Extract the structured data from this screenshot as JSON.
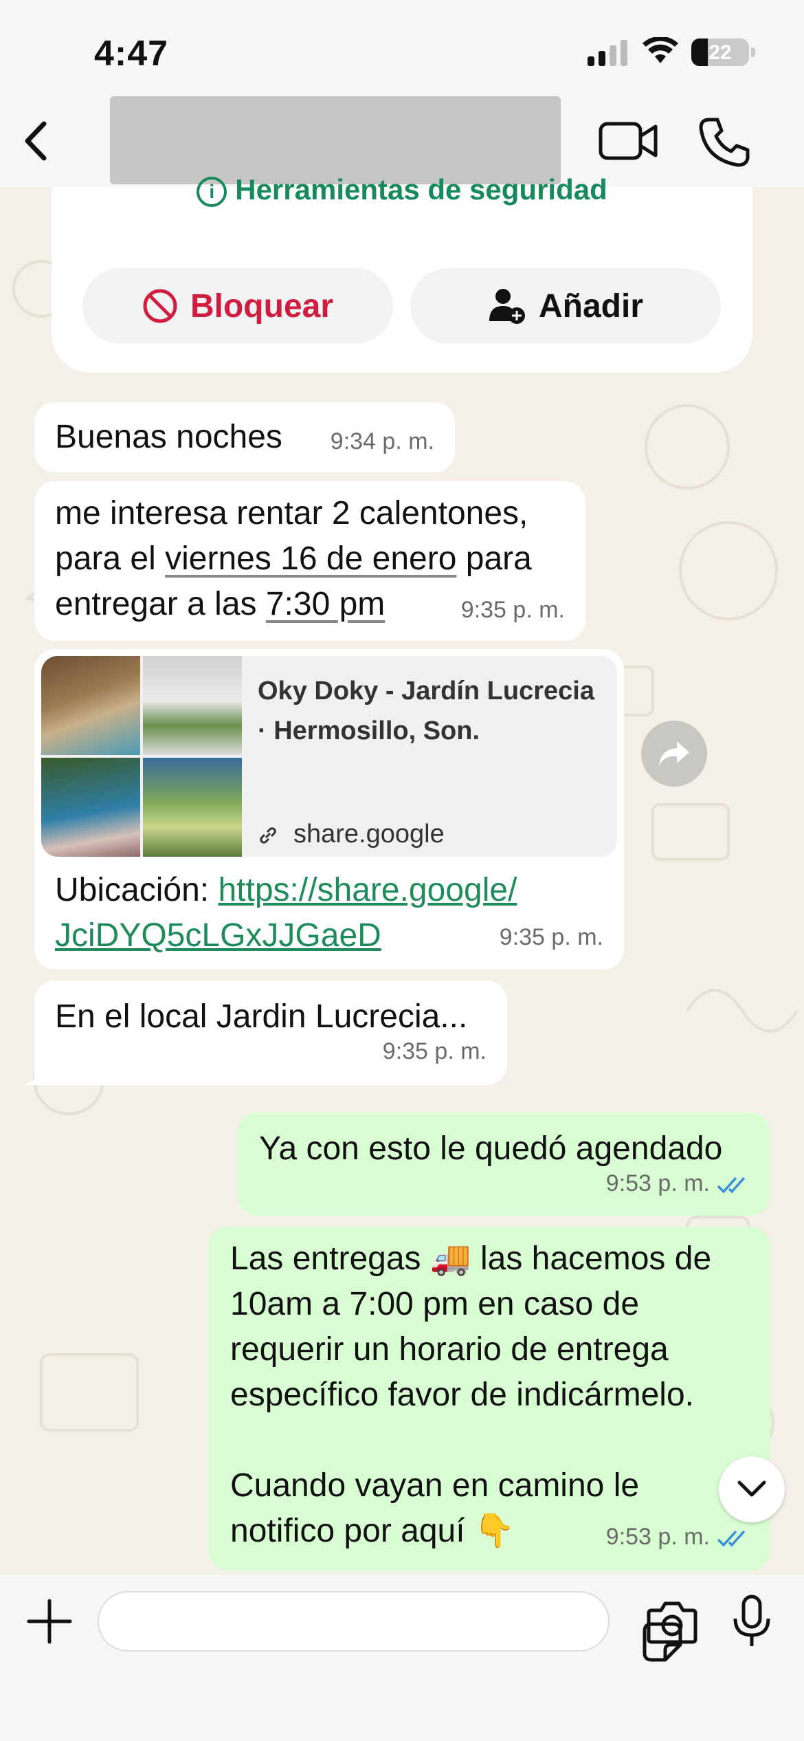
{
  "status_bar": {
    "time": "4:47",
    "battery": "22"
  },
  "header": {
    "contact_name": ""
  },
  "security_card": {
    "link_label": "Herramientas de seguridad",
    "block_label": "Bloquear",
    "add_label": "Añadir"
  },
  "messages": [
    {
      "dir": "in",
      "text": "Buenas noches",
      "time": "9:34 p. m."
    },
    {
      "dir": "in",
      "text_parts": [
        "me interesa rentar 2 calentones,",
        "para el ",
        "viernes 16 de enero",
        " para",
        "entregar a las ",
        "7:30 pm"
      ],
      "time": "9:35 p. m."
    },
    {
      "dir": "in",
      "location": {
        "title": "Oky Doky - Jardín Lucrecia · Hermosillo, Son.",
        "domain": "share.google"
      },
      "text_prefix": "Ubicación: ",
      "link": "https://share.google/JciDYQ5cLGxJJGaeD",
      "link_line1": "https://share.google/",
      "link_line2": "JciDYQ5cLGxJJGaeD",
      "time": "9:35 p. m."
    },
    {
      "dir": "in",
      "text": "En el local Jardin Lucrecia...",
      "time": "9:35 p. m."
    },
    {
      "dir": "out",
      "text": "Ya con esto le quedó agendado",
      "time": "9:53 p. m.",
      "status": "read"
    },
    {
      "dir": "out",
      "text_lines": [
        "Las entregas 🚚 las hacemos de",
        "10am a 7:00 pm en caso de",
        "requerir un horario de entrega",
        "específico favor de indicármelo.",
        "",
        "Cuando vayan en camino le",
        "notifico por aquí 👇"
      ],
      "time": "9:53 p. m.",
      "status": "read"
    }
  ],
  "input": {
    "placeholder": ""
  },
  "colors": {
    "incoming": "#ffffff",
    "outgoing": "#d9fdd3",
    "accent": "#168a5a",
    "danger": "#d01d3f",
    "read_ticks": "#3a8fd8"
  }
}
